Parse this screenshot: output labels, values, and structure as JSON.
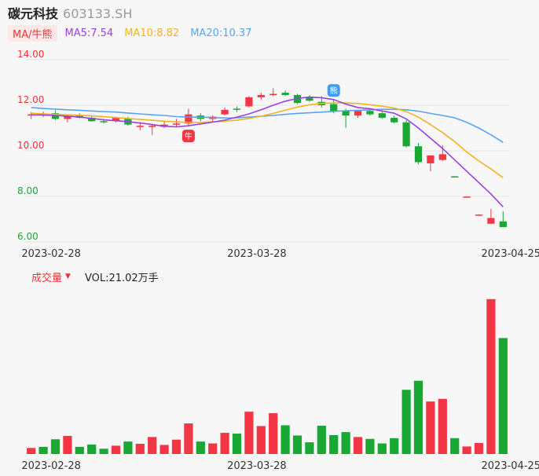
{
  "header": {
    "name": "碳元科技",
    "code": "603133.SH"
  },
  "legend": {
    "tag": "MA/牛熊",
    "ma5": {
      "label": "MA5:7.54",
      "color": "#9b3fe0"
    },
    "ma10": {
      "label": "MA10:8.82",
      "color": "#f5b31c"
    },
    "ma20": {
      "label": "MA20:10.37",
      "color": "#5aa3f0"
    }
  },
  "volume_legend": {
    "label": "成交量",
    "value": "VOL:21.02万手"
  },
  "colors": {
    "up": "#f23645",
    "down": "#1aa835",
    "grid": "#e5e5e5",
    "price_label": "#e33",
    "price_label_low": "#1aa835"
  },
  "badges": {
    "bull": "牛",
    "bear": "熊"
  },
  "chart_data": [
    {
      "type": "candlestick",
      "y_ticks": [
        "14.00",
        "12.00",
        "10.00",
        "8.00",
        "6.00"
      ],
      "ylim": [
        6,
        14
      ],
      "x_tick_labels": [
        "2023-02-28",
        "2023-03-28",
        "2023-04-25"
      ],
      "x_tick_index": [
        1,
        18,
        39
      ],
      "candles": [
        {
          "o": 11.55,
          "h": 11.7,
          "l": 11.4,
          "c": 11.6
        },
        {
          "o": 11.62,
          "h": 11.72,
          "l": 11.48,
          "c": 11.55
        },
        {
          "o": 11.65,
          "h": 11.78,
          "l": 11.35,
          "c": 11.4
        },
        {
          "o": 11.4,
          "h": 11.6,
          "l": 11.25,
          "c": 11.5
        },
        {
          "o": 11.55,
          "h": 11.65,
          "l": 11.42,
          "c": 11.45
        },
        {
          "o": 11.45,
          "h": 11.55,
          "l": 11.28,
          "c": 11.3
        },
        {
          "o": 11.3,
          "h": 11.4,
          "l": 11.2,
          "c": 11.25
        },
        {
          "o": 11.3,
          "h": 11.5,
          "l": 11.25,
          "c": 11.45
        },
        {
          "o": 11.4,
          "h": 11.5,
          "l": 11.1,
          "c": 11.15
        },
        {
          "o": 11.05,
          "h": 11.25,
          "l": 10.9,
          "c": 11.1
        },
        {
          "o": 11.05,
          "h": 11.15,
          "l": 10.7,
          "c": 11.1
        },
        {
          "o": 11.05,
          "h": 11.3,
          "l": 11.0,
          "c": 11.15
        },
        {
          "o": 11.15,
          "h": 11.4,
          "l": 11.05,
          "c": 11.2
        },
        {
          "o": 11.2,
          "h": 11.85,
          "l": 11.1,
          "c": 11.6
        },
        {
          "o": 11.55,
          "h": 11.65,
          "l": 11.3,
          "c": 11.4
        },
        {
          "o": 11.4,
          "h": 11.55,
          "l": 11.25,
          "c": 11.5
        },
        {
          "o": 11.6,
          "h": 11.9,
          "l": 11.55,
          "c": 11.8
        },
        {
          "o": 11.85,
          "h": 11.95,
          "l": 11.7,
          "c": 11.8
        },
        {
          "o": 11.95,
          "h": 12.4,
          "l": 11.9,
          "c": 12.35
        },
        {
          "o": 12.35,
          "h": 12.55,
          "l": 12.25,
          "c": 12.45
        },
        {
          "o": 12.45,
          "h": 12.75,
          "l": 12.4,
          "c": 12.5
        },
        {
          "o": 12.55,
          "h": 12.65,
          "l": 12.4,
          "c": 12.45
        },
        {
          "o": 12.45,
          "h": 12.5,
          "l": 12.05,
          "c": 12.1
        },
        {
          "o": 12.35,
          "h": 12.45,
          "l": 12.15,
          "c": 12.2
        },
        {
          "o": 12.15,
          "h": 12.4,
          "l": 11.9,
          "c": 12.0
        },
        {
          "o": 12.05,
          "h": 12.25,
          "l": 11.65,
          "c": 11.75
        },
        {
          "o": 11.75,
          "h": 11.85,
          "l": 11.0,
          "c": 11.55
        },
        {
          "o": 11.55,
          "h": 11.8,
          "l": 11.45,
          "c": 11.75
        },
        {
          "o": 11.75,
          "h": 11.85,
          "l": 11.55,
          "c": 11.6
        },
        {
          "o": 11.65,
          "h": 11.75,
          "l": 11.4,
          "c": 11.45
        },
        {
          "o": 11.45,
          "h": 11.55,
          "l": 11.2,
          "c": 11.25
        },
        {
          "o": 11.25,
          "h": 11.35,
          "l": 10.15,
          "c": 10.2
        },
        {
          "o": 10.2,
          "h": 10.35,
          "l": 9.4,
          "c": 9.5
        },
        {
          "o": 9.45,
          "h": 9.8,
          "l": 9.1,
          "c": 9.8
        },
        {
          "o": 9.6,
          "h": 10.25,
          "l": 9.55,
          "c": 9.85
        },
        {
          "o": 8.88,
          "h": 8.89,
          "l": 8.86,
          "c": 8.87
        },
        {
          "o": 7.99,
          "h": 8.0,
          "l": 7.98,
          "c": 7.99
        },
        {
          "o": 7.2,
          "h": 7.21,
          "l": 7.19,
          "c": 7.2
        },
        {
          "o": 6.8,
          "h": 7.45,
          "l": 6.8,
          "c": 7.05
        },
        {
          "o": 6.9,
          "h": 7.35,
          "l": 6.65,
          "c": 6.65
        }
      ],
      "ma5": [
        11.58,
        11.57,
        11.55,
        11.52,
        11.48,
        11.42,
        11.36,
        11.32,
        11.28,
        11.22,
        11.15,
        11.08,
        11.05,
        11.1,
        11.18,
        11.26,
        11.35,
        11.48,
        11.62,
        11.8,
        12.0,
        12.18,
        12.3,
        12.36,
        12.33,
        12.25,
        12.05,
        11.9,
        11.85,
        11.75,
        11.65,
        11.4,
        11.0,
        10.55,
        10.1,
        9.6,
        9.1,
        8.6,
        8.1,
        7.54
      ],
      "ma10": [
        11.65,
        11.62,
        11.6,
        11.58,
        11.56,
        11.53,
        11.5,
        11.46,
        11.42,
        11.38,
        11.34,
        11.3,
        11.27,
        11.25,
        11.25,
        11.27,
        11.3,
        11.35,
        11.42,
        11.52,
        11.64,
        11.78,
        11.92,
        12.02,
        12.08,
        12.1,
        12.1,
        12.08,
        12.02,
        11.96,
        11.88,
        11.72,
        11.48,
        11.15,
        10.8,
        10.4,
        9.95,
        9.55,
        9.2,
        8.82
      ],
      "ma20": [
        11.9,
        11.86,
        11.83,
        11.8,
        11.78,
        11.75,
        11.72,
        11.7,
        11.66,
        11.62,
        11.58,
        11.55,
        11.5,
        11.48,
        11.48,
        11.46,
        11.44,
        11.45,
        11.48,
        11.52,
        11.55,
        11.6,
        11.64,
        11.67,
        11.7,
        11.73,
        11.76,
        11.78,
        11.8,
        11.82,
        11.82,
        11.8,
        11.74,
        11.64,
        11.55,
        11.45,
        11.25,
        11.0,
        10.7,
        10.37
      ]
    },
    {
      "type": "bar",
      "series_name": "成交量",
      "unit": "万手",
      "values": [
        1.6,
        1.9,
        3.9,
        4.8,
        1.9,
        2.5,
        1.4,
        2.2,
        3.3,
        2.7,
        4.5,
        2.4,
        3.8,
        8.1,
        3.3,
        2.8,
        5.6,
        5.4,
        11.2,
        7.4,
        10.8,
        7.6,
        4.9,
        3.1,
        7.5,
        5.0,
        5.8,
        4.5,
        4.0,
        2.8,
        4.2,
        17.0,
        19.4,
        13.9,
        14.6,
        4.2,
        2.0,
        2.9,
        41.0,
        30.7
      ],
      "ylim": [
        0,
        42
      ],
      "x_tick_labels": [
        "2023-02-28",
        "2023-03-28",
        "2023-04-25"
      ]
    }
  ]
}
